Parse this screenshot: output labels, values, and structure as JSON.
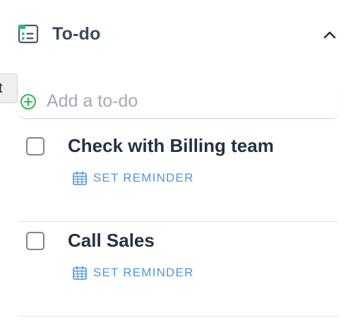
{
  "panel": {
    "title": "To-do",
    "header_icon": "todo-list-icon",
    "collapse_icon": "chevron-up-icon"
  },
  "side_tab": {
    "label": "t"
  },
  "add_todo": {
    "placeholder": "Add a to-do",
    "icon": "plus-circle-icon"
  },
  "todos": [
    {
      "title": "Check with Billing team",
      "reminder_label": "SET REMINDER",
      "checked": false
    },
    {
      "title": "Call Sales",
      "reminder_label": "SET REMINDER",
      "checked": false
    }
  ],
  "colors": {
    "title_text": "#3b4a5c",
    "item_text": "#233244",
    "accent_blue": "#4f95de",
    "add_green": "#34a853",
    "placeholder": "#a2aab5"
  }
}
